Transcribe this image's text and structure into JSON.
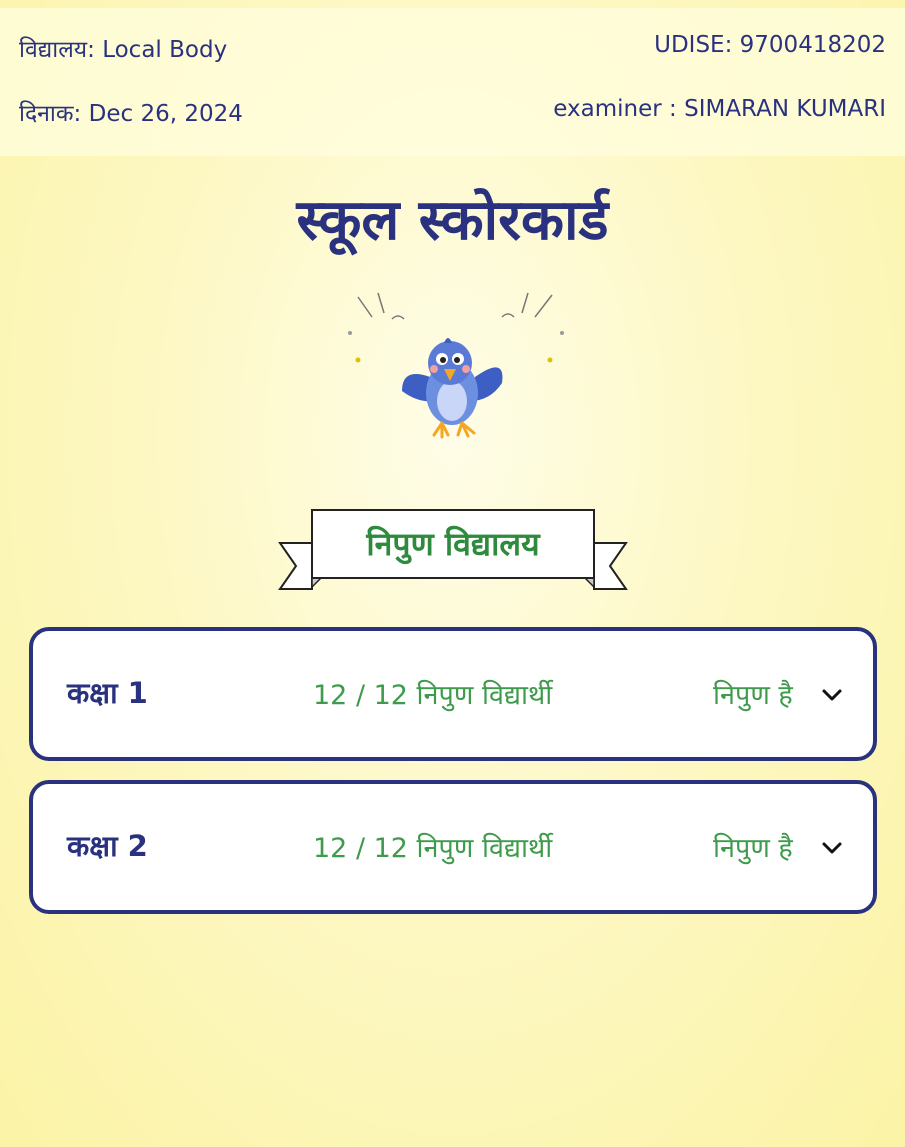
{
  "header": {
    "school_label": "विद्यालय:",
    "school_value": "Local Body",
    "udise_label": "UDISE:",
    "udise_value": "9700418202",
    "date_label": "दिनाक:",
    "date_value": "Dec 26, 2024",
    "examiner_label": "examiner :",
    "examiner_value": "SIMARAN KUMARI"
  },
  "title": "स्कूल स्कोरकार्ड",
  "badge": "निपुण विद्यालय",
  "classes": [
    {
      "name": "कक्षा 1",
      "count": "12 / 12 निपुण विद्यार्थी",
      "status": "निपुण है"
    },
    {
      "name": "कक्षा 2",
      "count": "12 / 12 निपुण विद्यार्थी",
      "status": "निपुण है"
    }
  ],
  "colors": {
    "primary": "#2a3280",
    "success": "#3f9b4c",
    "background": "#fbf3a6"
  },
  "icons": {
    "mascot": "bird-mascot-icon",
    "expand": "chevron-down-icon"
  }
}
